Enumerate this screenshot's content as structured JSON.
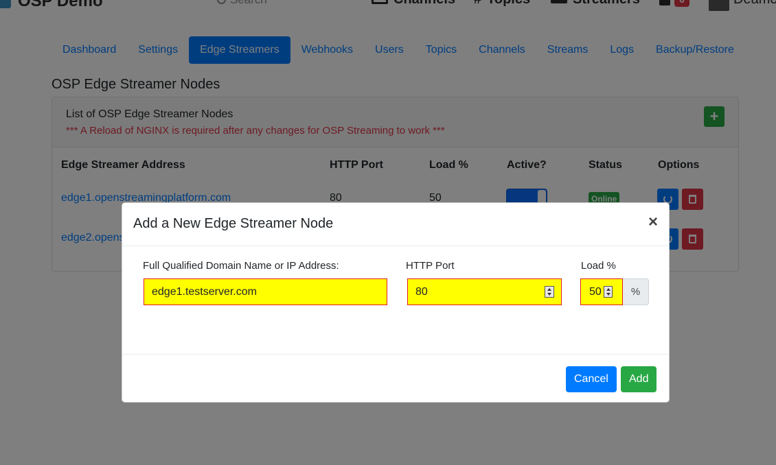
{
  "navbar": {
    "brand": "OSP Demo",
    "search_placeholder": "Search",
    "channels": "Channels",
    "topics": "Topics",
    "streamers": "Streamers",
    "notification_count": "6",
    "username": "Deamo"
  },
  "tabs": [
    {
      "label": "Dashboard",
      "active": false
    },
    {
      "label": "Settings",
      "active": false
    },
    {
      "label": "Edge Streamers",
      "active": true
    },
    {
      "label": "Webhooks",
      "active": false
    },
    {
      "label": "Users",
      "active": false
    },
    {
      "label": "Topics",
      "active": false
    },
    {
      "label": "Channels",
      "active": false
    },
    {
      "label": "Streams",
      "active": false
    },
    {
      "label": "Logs",
      "active": false
    },
    {
      "label": "Backup/Restore",
      "active": false
    }
  ],
  "page": {
    "title": "OSP Edge Streamer Nodes",
    "card_title": "List of OSP Edge Streamer Nodes",
    "card_warning": "*** A Reload of NGINX is required after any changes for OSP Streaming to work ***",
    "add_button": "+"
  },
  "table": {
    "headers": {
      "address": "Edge Streamer Address",
      "port": "HTTP Port",
      "load": "Load %",
      "active": "Active?",
      "status": "Status",
      "options": "Options"
    },
    "rows": [
      {
        "address": "edge1.openstreamingplatform.com",
        "port": "80",
        "load": "50",
        "active": true,
        "status": "Online"
      },
      {
        "address": "edge2.opens",
        "port": "",
        "load": "",
        "active": true,
        "status": ""
      }
    ]
  },
  "modal": {
    "title": "Add a New Edge Streamer Node",
    "close": "×",
    "fqdn_label": "Full Qualified Domain Name or IP Address:",
    "fqdn_value": "edge1.testserver.com",
    "port_label": "HTTP Port",
    "port_value": "80",
    "load_label": "Load %",
    "load_value": "50",
    "load_unit": "%",
    "cancel": "Cancel",
    "add": "Add"
  },
  "colors": {
    "primary": "#007bff",
    "success": "#28a745",
    "danger": "#dc3545",
    "field_highlight": "#ffff00",
    "field_border": "#e31b1b"
  }
}
